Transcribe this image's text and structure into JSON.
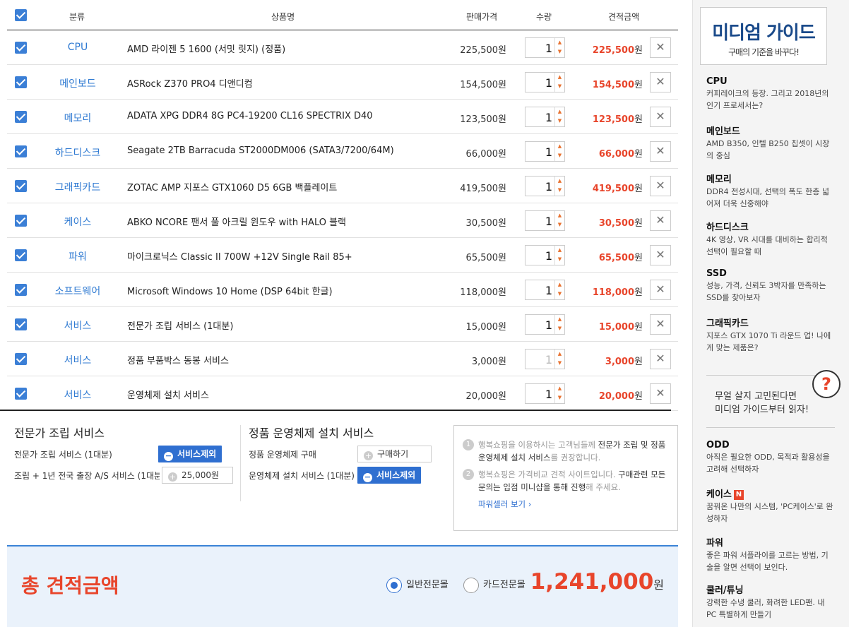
{
  "header": {
    "category": "분류",
    "product": "상품명",
    "price": "판매가격",
    "qty": "수량",
    "total": "견적금액"
  },
  "rows": [
    {
      "cat": "CPU",
      "name": "AMD 라이젠 5 1600 (서밋 릿지) (정품)",
      "price": "225,500원",
      "qty": "1",
      "total": "225,500"
    },
    {
      "cat": "메인보드",
      "name": "ASRock Z370 PRO4 디앤디컴",
      "price": "154,500원",
      "qty": "1",
      "total": "154,500"
    },
    {
      "cat": "메모리",
      "name": "ADATA XPG DDR4 8G PC4-19200 CL16 SPECTRIX D40",
      "price": "123,500원",
      "qty": "1",
      "total": "123,500"
    },
    {
      "cat": "하드디스크",
      "name": "Seagate 2TB Barracuda ST2000DM006 (SATA3/7200/64M)",
      "price": "66,000원",
      "qty": "1",
      "total": "66,000"
    },
    {
      "cat": "그래픽카드",
      "name": "ZOTAC AMP 지포스 GTX1060 D5 6GB 백플레이트",
      "price": "419,500원",
      "qty": "1",
      "total": "419,500"
    },
    {
      "cat": "케이스",
      "name": "ABKO NCORE 팬서 풀 아크릴 윈도우 with HALO 블랙",
      "price": "30,500원",
      "qty": "1",
      "total": "30,500"
    },
    {
      "cat": "파워",
      "name": "마이크로닉스 Classic II 700W +12V Single Rail 85+",
      "price": "65,500원",
      "qty": "1",
      "total": "65,500"
    },
    {
      "cat": "소프트웨어",
      "name": "Microsoft Windows 10 Home (DSP 64bit 한글)",
      "price": "118,000원",
      "qty": "1",
      "total": "118,000"
    },
    {
      "cat": "서비스",
      "name": "전문가 조립 서비스 (1대분)",
      "price": "15,000원",
      "qty": "1",
      "total": "15,000"
    },
    {
      "cat": "서비스",
      "name": "정품 부품박스 동봉 서비스",
      "price": "3,000원",
      "qty": "1",
      "total": "3,000"
    },
    {
      "cat": "서비스",
      "name": "운영체제 설치 서비스",
      "price": "20,000원",
      "qty": "1",
      "total": "20,000"
    }
  ],
  "won": "원",
  "assembly": {
    "title": "전문가 조립 서비스",
    "item1": "전문가 조립 서비스 (1대분)",
    "btn1": "서비스제외",
    "item2": "조립 + 1년 전국 출장 A/S 서비스 (1대분)",
    "btn2": "25,000원"
  },
  "os": {
    "title": "정품 운영체제 설치 서비스",
    "item1": "정품 운영체제 구매",
    "btn1": "구매하기",
    "item2": "운영체제 설치 서비스 (1대분)",
    "btn2": "서비스제외"
  },
  "notice": {
    "p1a": "행복쇼핑을 이용하시는 고객님들께 ",
    "p1b": "전문가 조립 및 정품 운영체제 설치 서비스",
    "p1c": "를 권장합니다.",
    "p2a": "행복쇼핑은 가격비교 견적 사이트입니다. ",
    "p2b": "구매관련 모든 문의는 입점 미니샵을 통해 진행",
    "p2c": "해 주세요.",
    "link": "파워셀러 보기 ›"
  },
  "totals": {
    "label": "총 견적금액",
    "radio1": "일반전문몰",
    "radio2": "카드전문몰",
    "amount": "1,241,000",
    "unit": "원"
  },
  "side": {
    "title": "미디엄 가이드",
    "subtitle": "구매의 기준을 바꾸다!",
    "items": [
      {
        "h": "CPU",
        "d": "커피레이크의 등장. 그리고 2018년의 인기 프로세서는?"
      },
      {
        "h": "메인보드",
        "d": "AMD B350, 인텔 B250 칩셋이 시장의 중심"
      },
      {
        "h": "메모리",
        "d": "DDR4 전성시대, 선택의 폭도 한층 넓어져 더욱 신중해야"
      },
      {
        "h": "하드디스크",
        "d": "4K 영상, VR 시대를 대비하는 합리적 선택이 필요할 때"
      },
      {
        "h": "SSD",
        "d": "성능, 가격, 신뢰도 3박자를 만족하는 SSD를 찾아보자"
      },
      {
        "h": "그래픽카드",
        "d": "지포스 GTX 1070 Ti 라운드 업! 나에게 맞는 제품은?"
      }
    ],
    "ask1": "무얼 살지 고민된다면",
    "ask2": "미디엄 가이드부터 읽자!",
    "askq": "?",
    "items2": [
      {
        "h": "ODD",
        "d": "아직은 필요한 ODD, 목적과 활용성을 고려해 선택하자"
      },
      {
        "h": "케이스",
        "d": "꿈꿔온 나만의 시스템, 'PC케이스'로 완성하자",
        "badge": "N"
      },
      {
        "h": "파워",
        "d": "좋은 파워 서플라이를 고르는 방법, 기술을 알면 선택이 보인다."
      },
      {
        "h": "쿨러/튜닝",
        "d": "강력한 수냉 쿨러, 화려한 LED팬. 내 PC 특별하게 만들기"
      }
    ]
  }
}
